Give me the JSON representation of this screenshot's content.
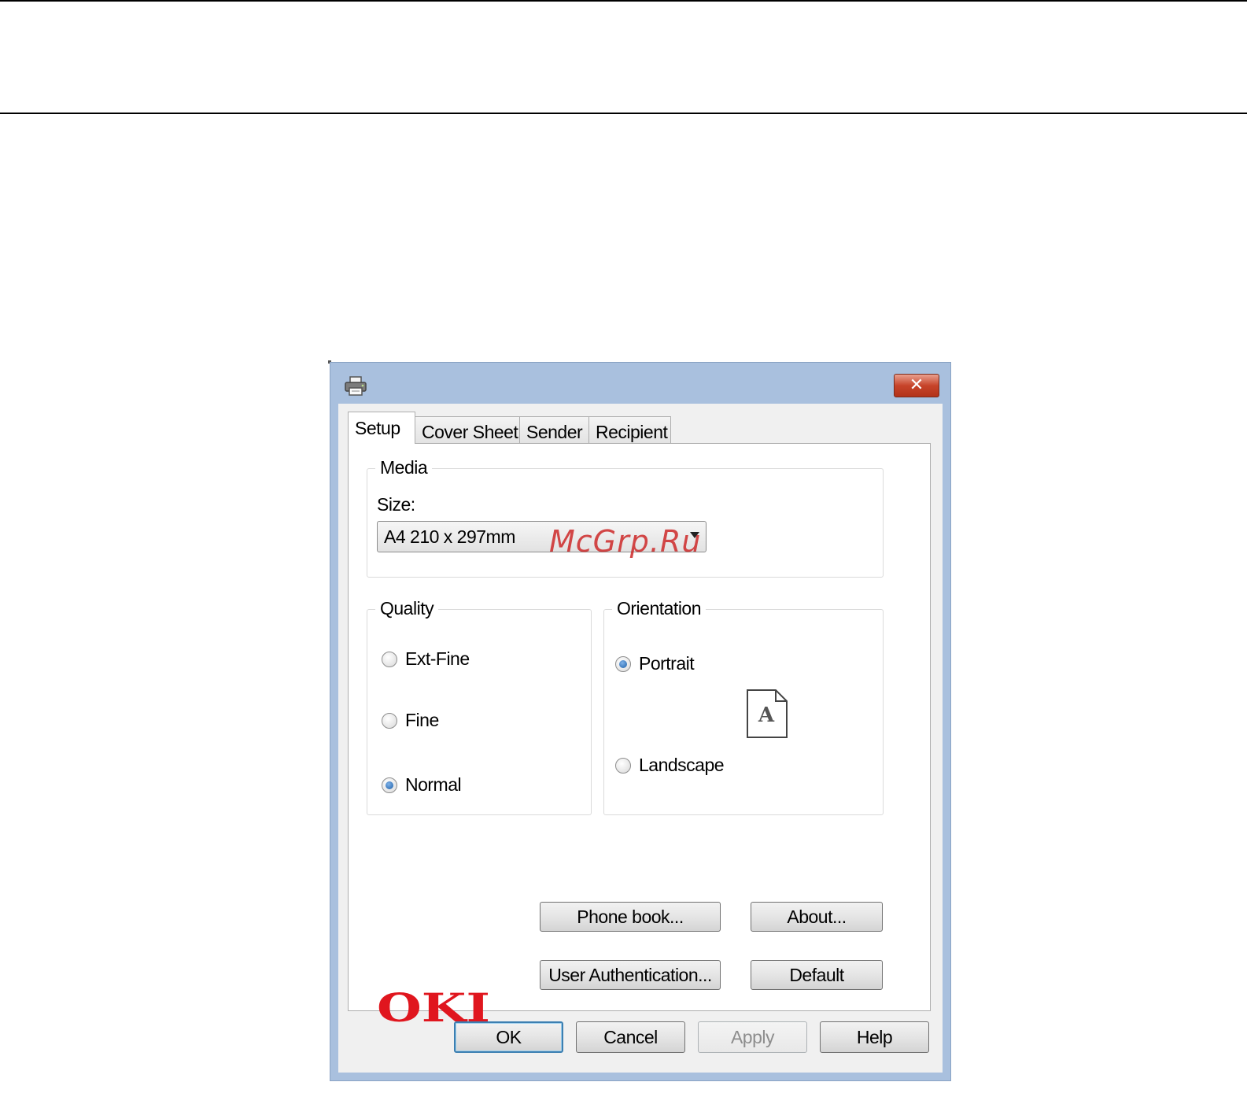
{
  "tabs": [
    {
      "label": "Setup",
      "active": true
    },
    {
      "label": "Cover Sheet",
      "active": false
    },
    {
      "label": "Sender",
      "active": false
    },
    {
      "label": "Recipient",
      "active": false
    }
  ],
  "media": {
    "group_label": "Media",
    "size_label": "Size:",
    "size_value": "A4 210 x 297mm"
  },
  "quality": {
    "group_label": "Quality",
    "options": [
      {
        "label": "Ext-Fine",
        "checked": false
      },
      {
        "label": "Fine",
        "checked": false
      },
      {
        "label": "Normal",
        "checked": true
      }
    ]
  },
  "orientation": {
    "group_label": "Orientation",
    "options": [
      {
        "label": "Portrait",
        "checked": true
      },
      {
        "label": "Landscape",
        "checked": false
      }
    ],
    "preview_letter": "A"
  },
  "panel_buttons": {
    "phone_book": "Phone book...",
    "about": "About...",
    "user_auth": "User Authentication...",
    "default": "Default"
  },
  "logo_text": "OKI",
  "dialog_buttons": {
    "ok": "OK",
    "cancel": "Cancel",
    "apply": "Apply",
    "help": "Help"
  },
  "watermark": "McGrp.Ru",
  "colors": {
    "logo_red": "#e0161e",
    "titlebar": "#a9c0de",
    "close_button": "#c7442a",
    "radio_checked": "#1d5fa8"
  },
  "icons": {
    "title": "printer-icon",
    "close": "close-icon",
    "combo": "chevron-down-icon"
  }
}
